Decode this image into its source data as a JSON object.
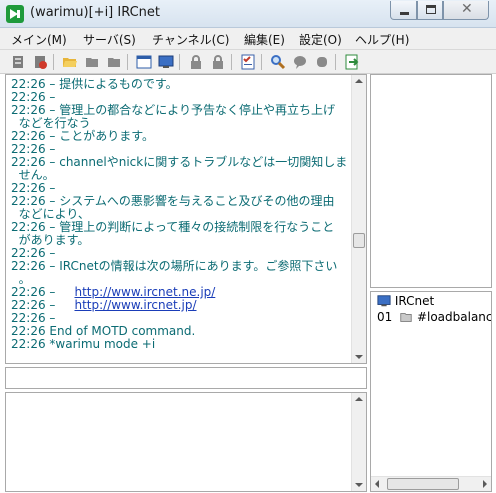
{
  "window": {
    "title": "(warimu)[+i] IRCnet"
  },
  "menu": [
    {
      "label": "メイン(M)"
    },
    {
      "label": "サーバ(S)"
    },
    {
      "label": "チャンネル(C)"
    },
    {
      "label": "編集(E)"
    },
    {
      "label": "設定(O)"
    },
    {
      "label": "ヘルプ(H)"
    }
  ],
  "toolbar": {
    "icons": [
      "server-icon",
      "disconnect-icon",
      "folder-open-icon",
      "folder-icon",
      "folder-icon",
      "window-icon",
      "monitor-icon",
      "lock-icon",
      "lock-icon",
      "person-icon",
      "checklist-icon",
      "search-icon",
      "balloon-icon",
      "gear-icon",
      "exit-icon"
    ]
  },
  "log": {
    "lines": [
      {
        "time": "22:26",
        "text": " – 提供によるものです。"
      },
      {
        "time": "22:26",
        "text": " –"
      },
      {
        "time": "22:26",
        "text": " – 管理上の都合などにより予告なく停止や再立ち上げ"
      },
      {
        "time": "",
        "text": "  などを行なう"
      },
      {
        "time": "22:26",
        "text": " – ことがあります。"
      },
      {
        "time": "22:26",
        "text": " –"
      },
      {
        "time": "22:26",
        "text": " – channelやnickに関するトラブルなどは一切関知しま"
      },
      {
        "time": "",
        "text": "  せん。"
      },
      {
        "time": "22:26",
        "text": " –"
      },
      {
        "time": "22:26",
        "text": " – システムへの悪影響を与えること及びその他の理由"
      },
      {
        "time": "",
        "text": "  などにより、"
      },
      {
        "time": "22:26",
        "text": " – 管理上の判断によって種々の接続制限を行なうこと"
      },
      {
        "time": "",
        "text": "  があります。"
      },
      {
        "time": "22:26",
        "text": " –"
      },
      {
        "time": "22:26",
        "text": " – IRCnetの情報は次の場所にあります。ご参照下さい"
      },
      {
        "time": "",
        "text": "  。"
      },
      {
        "time": "22:26",
        "text": " –     ",
        "url": "http://www.ircnet.ne.jp/"
      },
      {
        "time": "22:26",
        "text": " –     ",
        "url": "http://www.ircnet.jp/"
      },
      {
        "time": "22:26",
        "text": " –"
      },
      {
        "time": "22:26",
        "text": " End of MOTD command."
      },
      {
        "time": "22:26",
        "text": " *warimu mode +i"
      }
    ]
  },
  "channel_tree": {
    "server": "IRCnet",
    "channels": [
      {
        "index": "01",
        "name": "#loadbalancer"
      }
    ]
  },
  "colors": {
    "log_text": "#0b6b73",
    "url": "#1a3db8",
    "chrome": "#f0f0f0"
  }
}
